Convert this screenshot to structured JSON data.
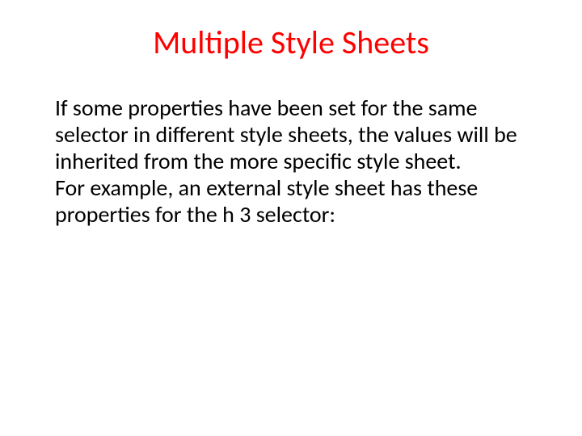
{
  "slide": {
    "title": "Multiple Style Sheets",
    "paragraph1": "If some properties have been set for the same selector in different style sheets, the values will be inherited from the more specific style sheet.",
    "paragraph2": "For example, an external style sheet has these properties for the h 3 selector:"
  }
}
